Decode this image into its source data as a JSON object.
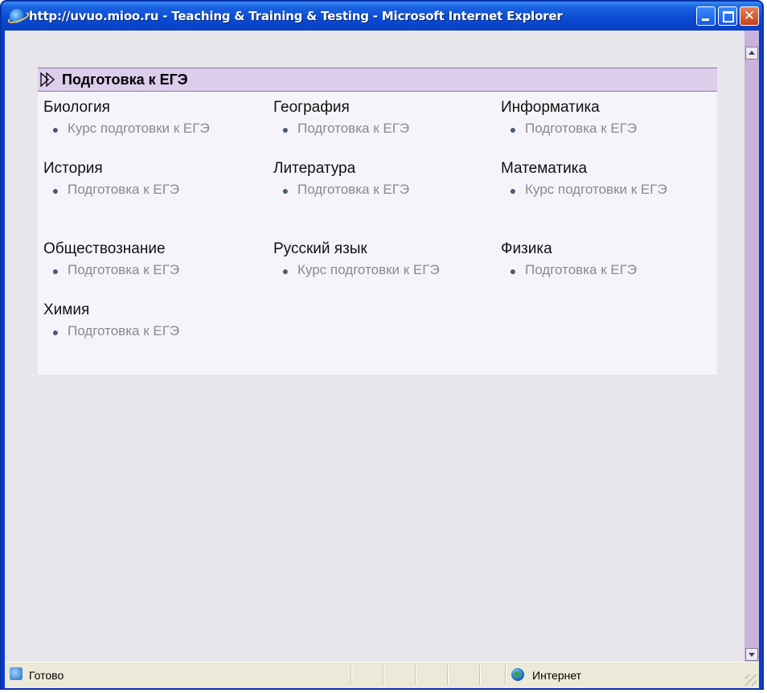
{
  "window": {
    "title": "http://uvuo.mioo.ru - Teaching & Training & Testing - Microsoft Internet Explorer",
    "close_glyph": "✕"
  },
  "panel": {
    "title": "Подготовка к ЕГЭ",
    "subjects": [
      {
        "name": "Биология",
        "course": "Курс подготовки к ЕГЭ"
      },
      {
        "name": "География",
        "course": "Подготовка к ЕГЭ"
      },
      {
        "name": "Информатика",
        "course": "Подготовка к ЕГЭ"
      },
      {
        "name": "История",
        "course": "Подготовка к ЕГЭ"
      },
      {
        "name": "Литература",
        "course": "Подготовка к ЕГЭ"
      },
      {
        "name": "Математика",
        "course": "Курс подготовки к ЕГЭ"
      },
      {
        "name": "Обществознание",
        "course": "Подготовка к ЕГЭ"
      },
      {
        "name": "Русский язык",
        "course": "Курс подготовки к ЕГЭ"
      },
      {
        "name": "Физика",
        "course": "Подготовка к ЕГЭ"
      },
      {
        "name": "Химия",
        "course": "Подготовка к ЕГЭ"
      }
    ],
    "bullet": "●"
  },
  "statusbar": {
    "status": "Готово",
    "zone": "Интернет"
  },
  "icons": {
    "title": "ie-icon",
    "header": "double-play-icon",
    "status": "ie-page-icon",
    "zone": "globe-icon"
  },
  "colors": {
    "titlebar": "#0a4ad4",
    "panel_header": "#dccdea",
    "scrollbar": "#cbb2dc",
    "course_text": "#8a8a8a"
  }
}
